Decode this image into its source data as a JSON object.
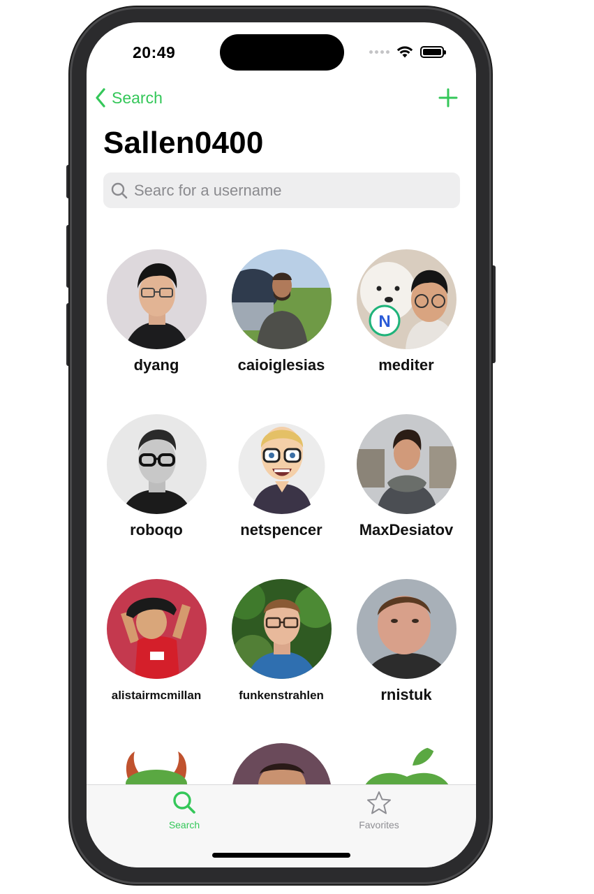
{
  "status_bar": {
    "time": "20:49"
  },
  "nav": {
    "back_label": "Search"
  },
  "page": {
    "title": "Sallen0400"
  },
  "search": {
    "placeholder": "Searc for a username"
  },
  "users": [
    {
      "username": "dyang"
    },
    {
      "username": "caioiglesias"
    },
    {
      "username": "mediter"
    },
    {
      "username": "roboqo"
    },
    {
      "username": "netspencer"
    },
    {
      "username": "MaxDesiatov"
    },
    {
      "username": "alistairmcmillan"
    },
    {
      "username": "funkenstrahlen"
    },
    {
      "username": "rnistuk"
    }
  ],
  "tab_bar": {
    "items": [
      {
        "label": "Search",
        "icon": "magnifying-glass-icon",
        "active": true
      },
      {
        "label": "Favorites",
        "icon": "star-icon",
        "active": false
      }
    ]
  },
  "colors": {
    "accent": "#34c759",
    "search_field_bg": "#eeeeef",
    "inactive_tab": "#8e8e93"
  }
}
